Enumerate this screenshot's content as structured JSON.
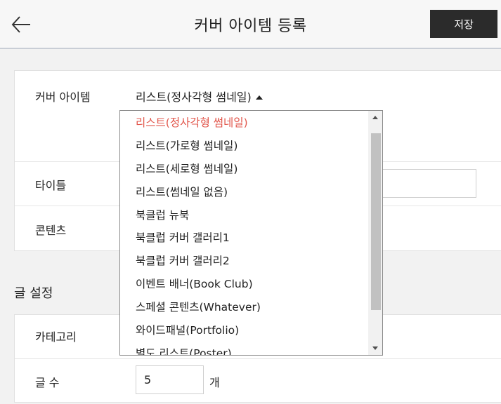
{
  "header": {
    "title": "커버 아이템 등록",
    "save_label": "저장"
  },
  "form": {
    "cover_item_label": "커버 아이템",
    "cover_item_value": "리스트(정사각형 썸네일)",
    "title_label": "타이틀",
    "content_label": "콘텐츠"
  },
  "post_settings": {
    "section_title": "글 설정",
    "category_label": "카테고리",
    "count_label": "글 수",
    "count_value": "5",
    "count_unit": "개"
  },
  "dropdown": {
    "selected_index": 0,
    "options": [
      "리스트(정사각형 썸네일)",
      "리스트(가로형 썸네일)",
      "리스트(세로형 썸네일)",
      "리스트(썸네일 없음)",
      "북클럽 뉴북",
      "북클럽 커버 갤러리1",
      "북클럽 커버 갤러리2",
      "이벤트 배너(Book Club)",
      "스페셜 콘텐츠(Whatever)",
      "와이드패널(Portfolio)",
      "별도 리스트(Poster)"
    ]
  },
  "colors": {
    "accent": "#e2574c",
    "save_button_bg": "#2b2b2b",
    "header_bg": "#f7f7f7",
    "page_bg": "#f2f2f2"
  },
  "icons": {
    "back": "arrow-left-icon",
    "select_caret": "caret-up-icon"
  }
}
